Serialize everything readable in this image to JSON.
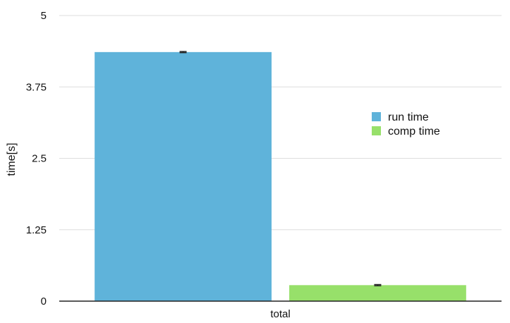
{
  "chart_data": {
    "type": "bar",
    "categories": [
      "total"
    ],
    "series": [
      {
        "name": "run time",
        "values": [
          4.36
        ],
        "error": [
          0.01
        ],
        "color": "#5fb3da"
      },
      {
        "name": "comp time",
        "values": [
          0.28
        ],
        "error": [
          0.01
        ],
        "color": "#97e06a"
      }
    ],
    "xlabel": "",
    "ylabel": "time[s]",
    "ylim": [
      0,
      5
    ],
    "yticks": [
      0,
      1.25,
      2.5,
      3.75,
      5
    ],
    "ytick_labels": [
      "0",
      "1.25",
      "2.5",
      "3.75",
      "5"
    ],
    "grid": true,
    "legend": "right"
  }
}
